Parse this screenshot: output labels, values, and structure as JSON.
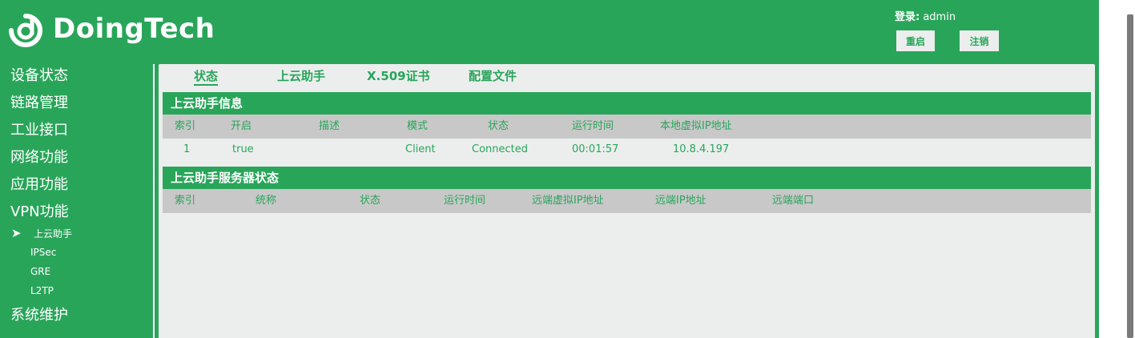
{
  "header": {
    "brand": "DoingTech",
    "login_label": "登录:",
    "login_user": "admin",
    "restart_label": "重启",
    "logout_label": "注销"
  },
  "sidebar": {
    "items": [
      {
        "label": "设备状态"
      },
      {
        "label": "链路管理"
      },
      {
        "label": "工业接口"
      },
      {
        "label": "网络功能"
      },
      {
        "label": "应用功能"
      },
      {
        "label": "VPN功能"
      },
      {
        "label": "系统维护"
      }
    ],
    "vpn_subitems": [
      {
        "label": "上云助手",
        "active": true
      },
      {
        "label": "IPSec"
      },
      {
        "label": "GRE"
      },
      {
        "label": "L2TP"
      }
    ],
    "active_marker": "➤"
  },
  "tabs": [
    {
      "label": "状态",
      "active": true
    },
    {
      "label": "上云助手"
    },
    {
      "label": "X.509证书"
    },
    {
      "label": "配置文件"
    }
  ],
  "info_section": {
    "title": "上云助手信息",
    "columns": [
      "索引",
      "开启",
      "描述",
      "模式",
      "状态",
      "运行时间",
      "本地虚拟IP地址"
    ],
    "rows": [
      {
        "index": "1",
        "enabled": "true",
        "desc": "",
        "mode": "Client",
        "status": "Connected",
        "uptime": "00:01:57",
        "local_vip": "10.8.4.197"
      }
    ]
  },
  "server_section": {
    "title": "上云助手服务器状态",
    "columns": [
      "索引",
      "统称",
      "状态",
      "运行时间",
      "远端虚拟IP地址",
      "远端IP地址",
      "远端端口"
    ],
    "rows": []
  },
  "colors": {
    "brand_green": "#29a55a",
    "panel_bg": "#eceeee",
    "table_header_bg": "#c8c8c8"
  }
}
